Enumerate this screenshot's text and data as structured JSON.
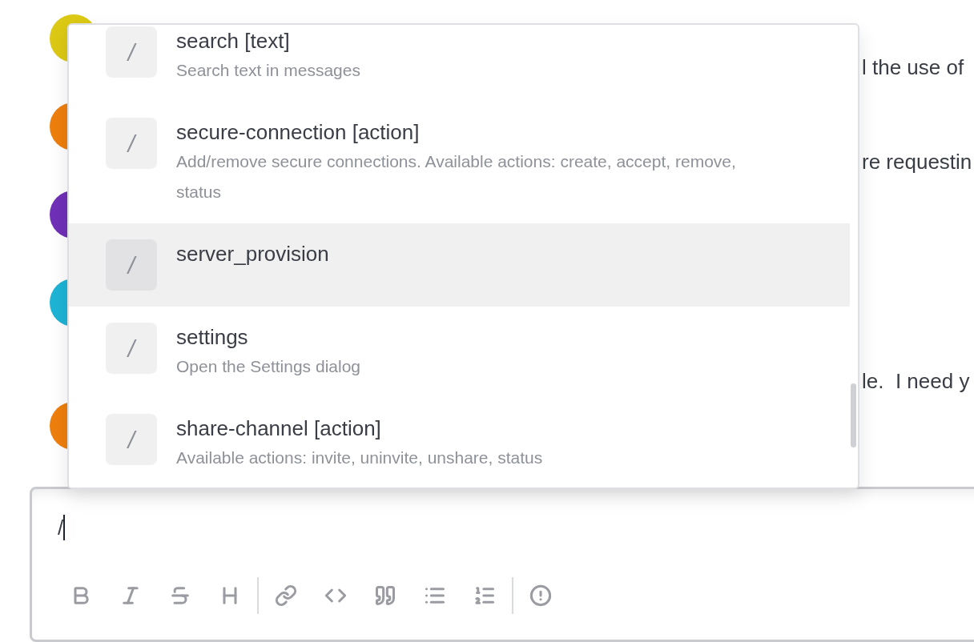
{
  "avatars": [
    {
      "color": "#dcc915"
    },
    {
      "color": "#ee7f0d"
    },
    {
      "color": "#7030b8"
    },
    {
      "color": "#1eb4d6"
    },
    {
      "color": "#ee7f0d"
    }
  ],
  "message_fragments": [
    "l the use of",
    "re requestin",
    "le.  I need y"
  ],
  "suggestions": [
    {
      "icon": "/",
      "title": "search [text]",
      "description": "Search text in messages",
      "selected": false
    },
    {
      "icon": "/",
      "title": "secure-connection [action]",
      "description": "Add/remove secure connections. Available actions: create, accept, remove, status",
      "selected": false
    },
    {
      "icon": "/",
      "title": "server_provision",
      "selected": true
    },
    {
      "icon": "/",
      "title": "settings",
      "description": "Open the Settings dialog",
      "selected": false
    },
    {
      "icon": "/",
      "title": "share-channel [action]",
      "description": "Available actions: invite, uninvite, unshare, status",
      "selected": false
    }
  ],
  "composer": {
    "value": "/"
  },
  "toolbar": [
    {
      "kind": "bold"
    },
    {
      "kind": "italic"
    },
    {
      "kind": "strikethrough"
    },
    {
      "kind": "heading"
    },
    {
      "kind": "divider"
    },
    {
      "kind": "link"
    },
    {
      "kind": "code"
    },
    {
      "kind": "quote"
    },
    {
      "kind": "bullet-list"
    },
    {
      "kind": "numbered-list"
    },
    {
      "kind": "divider"
    },
    {
      "kind": "info"
    }
  ]
}
